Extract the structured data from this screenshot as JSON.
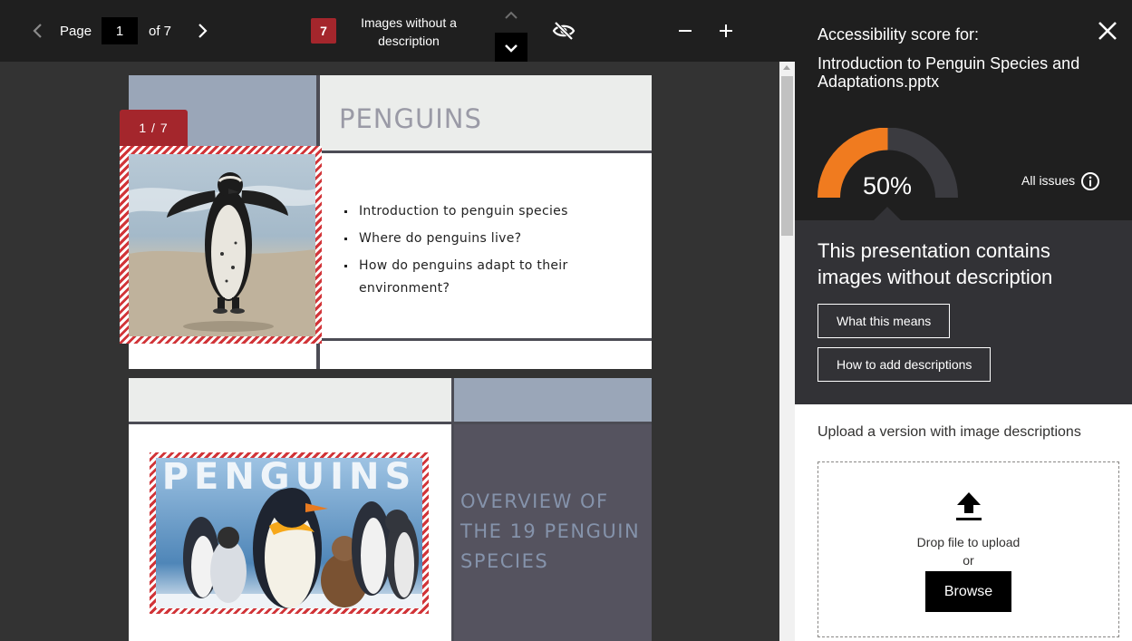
{
  "toolbar": {
    "page_label": "Page",
    "current_page": "1",
    "of_label": "of 7",
    "issue_count": "7",
    "issue_label": "Images without a description"
  },
  "slides": [
    {
      "badge": "1 / 7",
      "title": "PENGUINS",
      "bullets": [
        "Introduction to penguin species",
        "Where do penguins live?",
        "How do penguins adapt to their environment?"
      ]
    },
    {
      "image_text": "PENGUINS",
      "title": "OVERVIEW OF THE 19 PENGUIN SPECIES"
    }
  ],
  "panel": {
    "heading": "Accessibility score for:",
    "filename": "Introduction to Penguin Species and Adaptations.pptx",
    "score_text": "50%",
    "score_value": 0.5,
    "all_issues_label": "All issues",
    "message": "This presentation contains images without description",
    "what_means_label": "What this means",
    "how_to_label": "How to add descriptions",
    "upload_label": "Upload a version with image descriptions",
    "drop_text": "Drop file to upload",
    "or_text": "or",
    "browse_label": "Browse"
  },
  "colors": {
    "accent_red": "#a4262c",
    "gauge_fill": "#f07b1f",
    "gauge_track": "#3b3b40"
  },
  "icons": {
    "prev": "chevron-left-icon",
    "next": "chevron-right-icon",
    "up": "chevron-up-icon",
    "down": "chevron-down-icon",
    "hide": "eye-off-icon",
    "zoom_out": "minus-icon",
    "zoom_in": "plus-icon",
    "close": "close-icon",
    "info": "info-icon",
    "upload": "upload-icon"
  }
}
